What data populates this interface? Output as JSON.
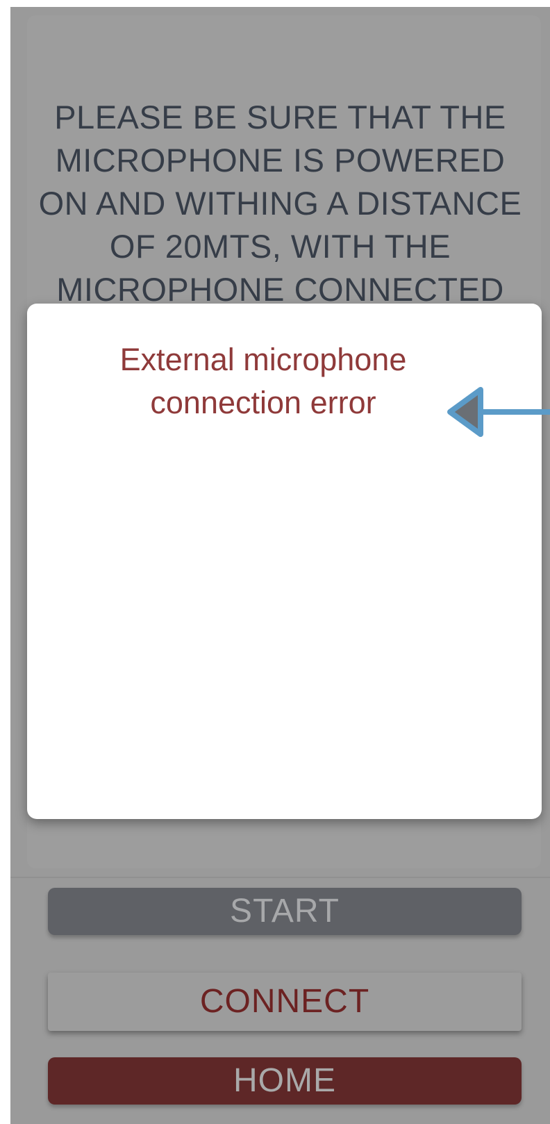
{
  "instructions": {
    "line1": "PLEASE BE SURE THAT THE",
    "line2": "MICROPHONE IS POWERED",
    "line3": "ON AND WITHING A DISTANCE",
    "line4": "OF 20MTS, WITH THE",
    "line5": "MICROPHONE CONNECTED"
  },
  "dialog": {
    "title_line1": "External microphone",
    "title_line2": "connection error"
  },
  "buttons": {
    "start": "START",
    "connect": "CONNECT",
    "home": "HOME"
  },
  "annotation": {
    "icon": "left-arrow-icon",
    "color": "#5b9bc8"
  },
  "colors": {
    "error_text": "#8f3a3a",
    "home_button": "#5e2727",
    "start_button": "#5f6166",
    "overlay": "#9a9a9a"
  }
}
